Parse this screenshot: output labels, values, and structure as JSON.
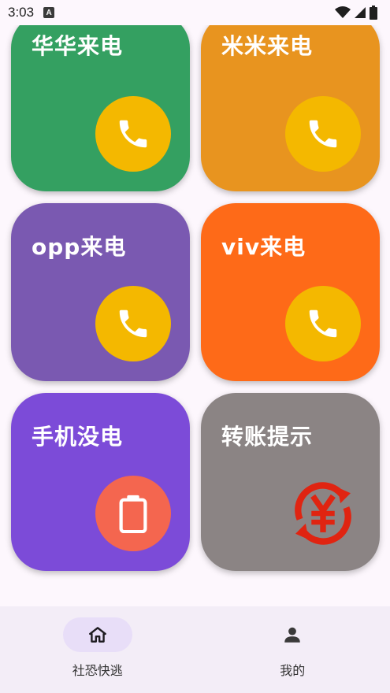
{
  "status_bar": {
    "time": "3:03",
    "notification_icon": "A"
  },
  "cards": [
    {
      "title": "华华来电",
      "color": "#34a061",
      "icon": "phone-icon",
      "icon_bg": "#f4b800"
    },
    {
      "title": "米米来电",
      "color": "#e8941f",
      "icon": "phone-icon",
      "icon_bg": "#f4b800"
    },
    {
      "title": "opp来电",
      "color": "#7a59b1",
      "icon": "phone-icon",
      "icon_bg": "#f4b800"
    },
    {
      "title": "viv来电",
      "color": "#fe6a18",
      "icon": "phone-icon",
      "icon_bg": "#f4b800"
    },
    {
      "title": "手机没电",
      "color": "#7c4bd8",
      "icon": "battery-empty-icon",
      "icon_bg": "#f4664f"
    },
    {
      "title": "转账提示",
      "color": "#8b8484",
      "icon": "yuan-transfer-icon",
      "icon_bg": ""
    }
  ],
  "bottom_nav": {
    "items": [
      {
        "label": "社恐快逃",
        "icon": "home-icon",
        "active": true
      },
      {
        "label": "我的",
        "icon": "person-icon",
        "active": false
      }
    ]
  }
}
